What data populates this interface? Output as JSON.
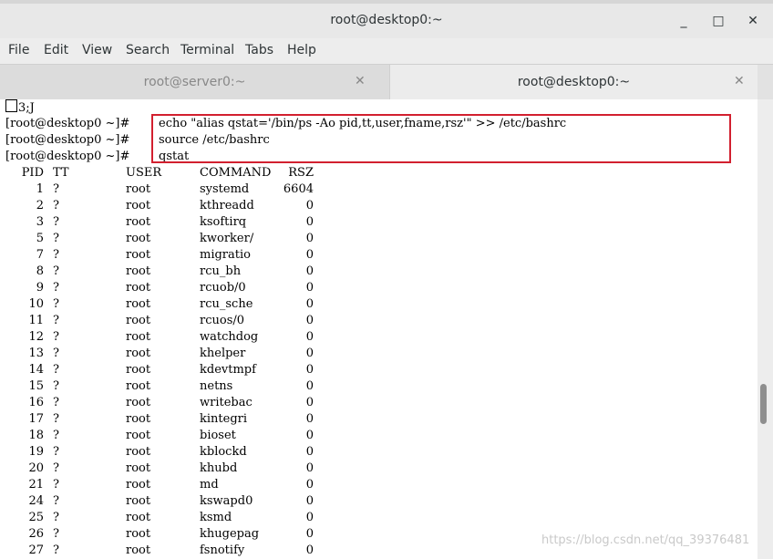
{
  "window": {
    "title": "root@desktop0:~",
    "minimize": "_",
    "maximize": "□",
    "close": "✕"
  },
  "menu": [
    "File",
    "Edit",
    "View",
    "Search",
    "Terminal",
    "Tabs",
    "Help"
  ],
  "tabs": [
    {
      "label": "root@server0:~",
      "active": false
    },
    {
      "label": "root@desktop0:~",
      "active": true
    }
  ],
  "tab_close_glyph": "✕",
  "terminal": {
    "first_line": "3;J",
    "prompts": [
      "[root@desktop0 ~]#",
      "[root@desktop0 ~]#",
      "[root@desktop0 ~]#"
    ],
    "commands": [
      "echo \"alias qstat='/bin/ps -Ao pid,tt,user,fname,rsz'\" >> /etc/bashrc",
      "source /etc/bashrc",
      "qstat"
    ],
    "columns": [
      "PID",
      "TT",
      "USER",
      "COMMAND",
      "RSZ"
    ],
    "rows": [
      [
        "1",
        "?",
        "root",
        "systemd",
        "6604"
      ],
      [
        "2",
        "?",
        "root",
        "kthreadd",
        "0"
      ],
      [
        "3",
        "?",
        "root",
        "ksoftirq",
        "0"
      ],
      [
        "5",
        "?",
        "root",
        "kworker/",
        "0"
      ],
      [
        "7",
        "?",
        "root",
        "migratio",
        "0"
      ],
      [
        "8",
        "?",
        "root",
        "rcu_bh",
        "0"
      ],
      [
        "9",
        "?",
        "root",
        "rcuob/0",
        "0"
      ],
      [
        "10",
        "?",
        "root",
        "rcu_sche",
        "0"
      ],
      [
        "11",
        "?",
        "root",
        "rcuos/0",
        "0"
      ],
      [
        "12",
        "?",
        "root",
        "watchdog",
        "0"
      ],
      [
        "13",
        "?",
        "root",
        "khelper",
        "0"
      ],
      [
        "14",
        "?",
        "root",
        "kdevtmpf",
        "0"
      ],
      [
        "15",
        "?",
        "root",
        "netns",
        "0"
      ],
      [
        "16",
        "?",
        "root",
        "writebac",
        "0"
      ],
      [
        "17",
        "?",
        "root",
        "kintegri",
        "0"
      ],
      [
        "18",
        "?",
        "root",
        "bioset",
        "0"
      ],
      [
        "19",
        "?",
        "root",
        "kblockd",
        "0"
      ],
      [
        "20",
        "?",
        "root",
        "khubd",
        "0"
      ],
      [
        "21",
        "?",
        "root",
        "md",
        "0"
      ],
      [
        "24",
        "?",
        "root",
        "kswapd0",
        "0"
      ],
      [
        "25",
        "?",
        "root",
        "ksmd",
        "0"
      ],
      [
        "26",
        "?",
        "root",
        "khugepag",
        "0"
      ],
      [
        "27",
        "?",
        "root",
        "fsnotify",
        "0"
      ]
    ]
  },
  "watermark": "https://blog.csdn.net/qq_39376481",
  "colors": {
    "highlight": "#d2202f",
    "terminal_bg": "#ffffff"
  }
}
